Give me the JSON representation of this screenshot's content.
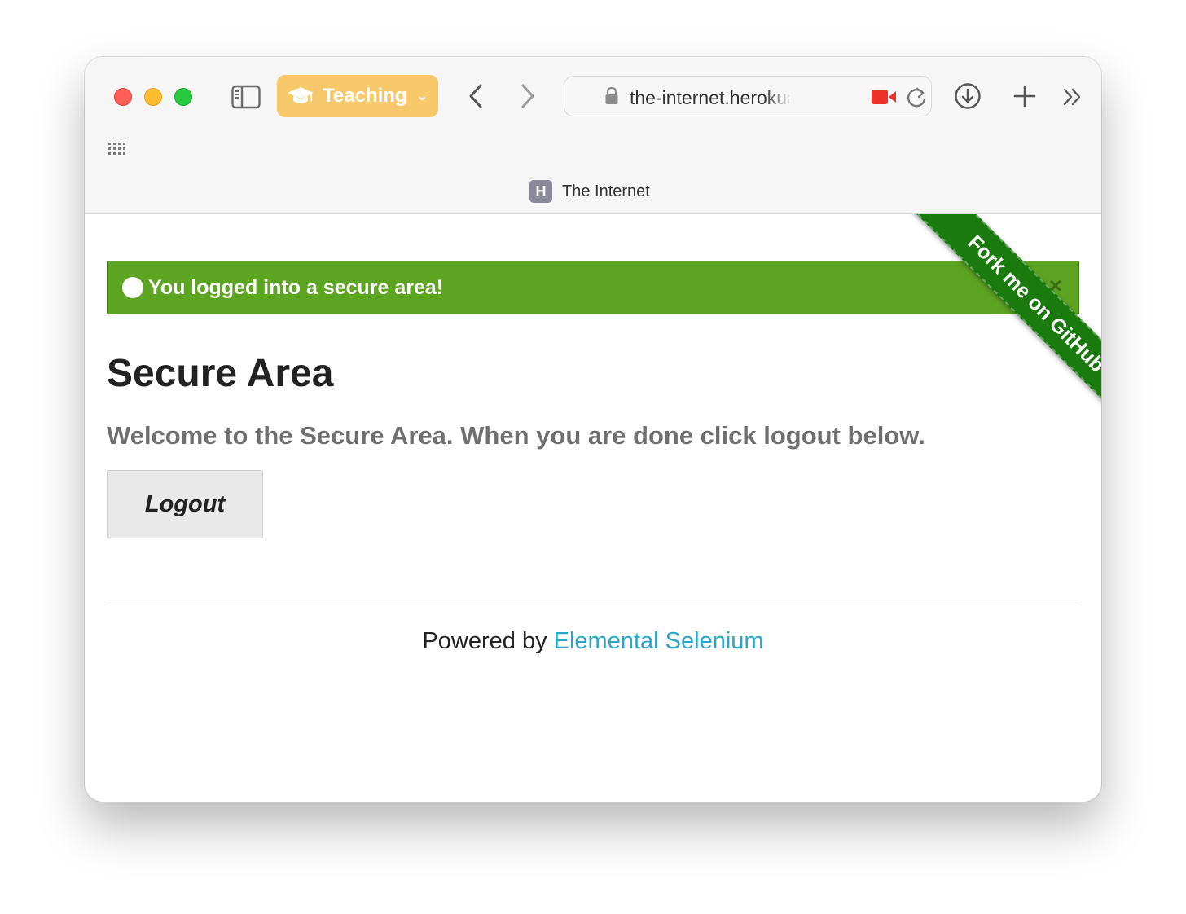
{
  "browser": {
    "tab_group": {
      "label": "Teaching",
      "icon": "graduation-cap-icon",
      "color": "#f7c96b"
    },
    "address_bar": {
      "url": "the-internet.herokuapp.com"
    },
    "tab": {
      "favicon_letter": "H",
      "title": "The Internet"
    }
  },
  "page": {
    "flash": {
      "message": "You logged into a secure area!",
      "close": "×",
      "color": "#5da423"
    },
    "ribbon": {
      "text": "Fork me on GitHub",
      "color": "#1a7a0e"
    },
    "heading": "Secure Area",
    "subheader": "Welcome to the Secure Area. When you are done click logout below.",
    "logout_label": "Logout",
    "footer": {
      "prefix": "Powered by ",
      "link_text": "Elemental Selenium",
      "link_color": "#2ba6cb"
    }
  }
}
